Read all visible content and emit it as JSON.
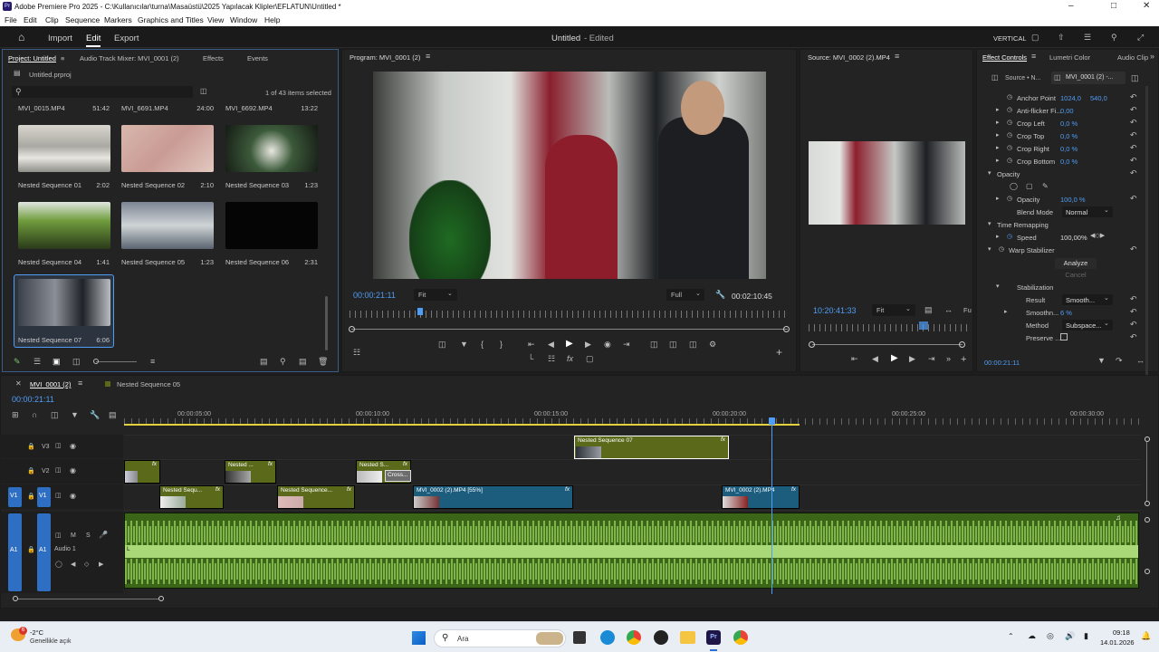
{
  "window": {
    "title": "Adobe Premiere Pro 2025 - C:\\Kullanıcılar\\turna\\Masaüstü\\2025 Yapılacak Klipler\\EFLATUN\\Untitled *"
  },
  "menu": [
    "File",
    "Edit",
    "Clip",
    "Sequence",
    "Markers",
    "Graphics and Titles",
    "View",
    "Window",
    "Help"
  ],
  "header": {
    "nav": [
      "Import",
      "Edit",
      "Export"
    ],
    "doc_title": "Untitled",
    "doc_status": "- Edited",
    "workspace": "VERTICAL"
  },
  "project": {
    "tabs": [
      "Project: Untitled",
      "Audio Track Mixer: MVI_0001 (2)",
      "Effects",
      "Events"
    ],
    "file": "Untitled.prproj",
    "selection": "1 of 43 items selected",
    "top_items": [
      {
        "name": "MVI_0015.MP4",
        "dur": "51:42"
      },
      {
        "name": "MVI_6691.MP4",
        "dur": "24:00"
      },
      {
        "name": "MVI_6692.MP4",
        "dur": "13:22"
      }
    ],
    "items": [
      {
        "name": "Nested Sequence 01",
        "dur": "2:02"
      },
      {
        "name": "Nested Sequence 02",
        "dur": "2:10"
      },
      {
        "name": "Nested Sequence 03",
        "dur": "1:23"
      },
      {
        "name": "Nested Sequence 04",
        "dur": "1:41"
      },
      {
        "name": "Nested Sequence 05",
        "dur": "1:23"
      },
      {
        "name": "Nested Sequence 06",
        "dur": "2:31"
      },
      {
        "name": "Nested Sequence 07",
        "dur": "6:06"
      }
    ]
  },
  "program": {
    "title": "Program: MVI_0001 (2)",
    "timecode": "00:00:21:11",
    "fit": "Fit",
    "quality": "Full",
    "duration": "00:02:10:45"
  },
  "source": {
    "title": "Source: MVI_0002 (2).MP4",
    "timecode": "10:20:41:33",
    "fit": "Fit",
    "fu": "Fu"
  },
  "effect_controls": {
    "tabs": [
      "Effect Controls",
      "Lumetri Color",
      "Audio Clip"
    ],
    "source_tab": "Source • N...",
    "clip_tab": "MVI_0001 (2) -...",
    "anchor_label": "Anchor Point",
    "anchor_x": "1024,0",
    "anchor_y": "540,0",
    "props": [
      {
        "label": "Anti-flicker Fi...",
        "value": "0,00"
      },
      {
        "label": "Crop Left",
        "value": "0,0 %"
      },
      {
        "label": "Crop Top",
        "value": "0,0 %"
      },
      {
        "label": "Crop Right",
        "value": "0,0 %"
      },
      {
        "label": "Crop Bottom",
        "value": "0,0 %"
      }
    ],
    "opacity_group": "Opacity",
    "opacity_label": "Opacity",
    "opacity_value": "100,0 %",
    "blend_label": "Blend Mode",
    "blend_value": "Normal",
    "time_remap": "Time Remapping",
    "speed_label": "Speed",
    "speed_value": "100,00%",
    "warp": "Warp Stabilizer",
    "analyze": "Analyze",
    "cancel": "Cancel",
    "stabilization": "Stabilization",
    "result_label": "Result",
    "result_value": "Smooth...",
    "smooth_label": "Smoothn...",
    "smooth_value": "6 %",
    "method_label": "Method",
    "method_value": "Subspace...",
    "preserve_label": "Preserve ...",
    "timecode": "00:00:21:11"
  },
  "timeline": {
    "tabs": [
      "MVI_0001 (2)",
      "Nested Sequence 05"
    ],
    "timecode": "00:00:21:11",
    "ruler": [
      "00:00:05:00",
      "00:00:10:00",
      "00:00:15:00",
      "00:00:20:00",
      "00:00:25:00",
      "00:00:30:00"
    ],
    "tracks": {
      "v3": "V3",
      "v2": "V2",
      "v1": "V1",
      "a1": "A1",
      "audio_name": "Audio 1",
      "m": "M",
      "s": "S"
    },
    "clips": {
      "v3_a": "Nested Sequence 07",
      "v2_b": "Nested ...",
      "v2_c": "Nested S...",
      "v2_cross": "Cross...",
      "v1_a": "Nested Sequ...",
      "v1_b": "Nested Sequence...",
      "v1_c": "MVI_0002 (2).MP4 [55%]",
      "v1_d": "MVI_0002 (2).MP4",
      "fx": "fx"
    }
  },
  "taskbar": {
    "weather_temp": "-2°C",
    "weather_desc": "Genellikle açık",
    "badge": "6",
    "search": "Ara",
    "time": "09:18",
    "date": "14.01.2026"
  }
}
